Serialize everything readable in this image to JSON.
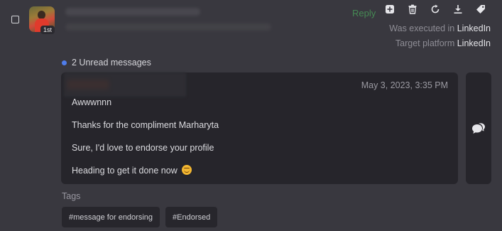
{
  "contact": {
    "degree": "1st"
  },
  "header": {
    "reply_label": "Reply",
    "toolbar_icons": [
      "add-note-icon",
      "trash-icon",
      "refresh-icon",
      "download-icon",
      "tag-icon"
    ]
  },
  "meta": {
    "executed_label": "Was executed in",
    "executed_value": "LinkedIn",
    "target_label": "Target platform",
    "target_value": "LinkedIn"
  },
  "unread": {
    "text": "2 Unread messages"
  },
  "message": {
    "date": "May 3, 2023, 3:35 PM",
    "lines": [
      "Awwwnnn",
      "Thanks for the compliment Marharyta",
      "Sure, I'd love to endorse your profile",
      "Heading to get it done now"
    ]
  },
  "tags": {
    "label": "Tags",
    "items": [
      "#message for endorsing",
      "#Endorsed"
    ]
  },
  "colors": {
    "background": "#39383f",
    "card": "#26252b",
    "accent_unread": "#4f7dec",
    "reply_green": "#4aa35a"
  }
}
